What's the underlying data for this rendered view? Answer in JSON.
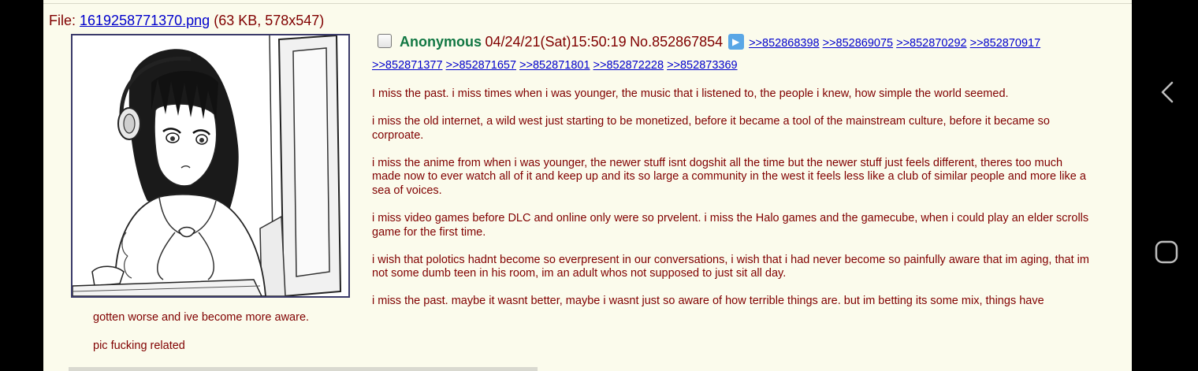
{
  "file": {
    "prefix": "File: ",
    "filename": "1619258771370.png",
    "meta": " (63 KB, 578x547)"
  },
  "post": {
    "name": "Anonymous",
    "datetime": "04/24/21(Sat)15:50:19",
    "number": "No.852867854",
    "backlinks_row1": [
      ">>852868398",
      ">>852869075",
      ">>852870292",
      ">>852870917"
    ],
    "backlinks_row2": [
      ">>852871377",
      ">>852871657",
      ">>852871801",
      ">>852872228",
      ">>852873369"
    ],
    "paragraphs": [
      "I miss the past. i miss times when i was younger, the music that i listened to, the people i knew, how simple the world seemed.",
      "i miss the old internet, a wild west just starting to be monetized, before it became a tool of the mainstream culture, before it became so corproate.",
      "i miss the anime from when i was younger, the newer stuff isnt dogshit all the time but the newer stuff just feels different, theres too much made now to ever watch all of it and keep up and its so large a community in the west it feels less like a club of similar people and more like a sea of voices.",
      "i miss video games before DLC and online only were so prvelent. i miss the Halo games and the gamecube, when i could play an elder scrolls game for the first time.",
      "i wish that polotics hadnt become so everpresent in our conversations, i wish that i had never become so painfully aware that im aging, that im not some dumb teen in his room, im an adult whos not supposed to just sit all day.",
      "i miss the past. maybe it wasnt better, maybe i wasnt just so aware of how terrible things are. but im betting its some mix, things have"
    ],
    "paragraphs_continued": [
      "gotten worse and ive become more aware.",
      "pic fucking related"
    ]
  },
  "icons": {
    "play": "play-icon",
    "back": "chevron-left-icon",
    "home": "rounded-square-icon"
  },
  "colors": {
    "background": "#fbfbec",
    "text": "#800000",
    "name": "#117743",
    "link": "#0000cc"
  }
}
